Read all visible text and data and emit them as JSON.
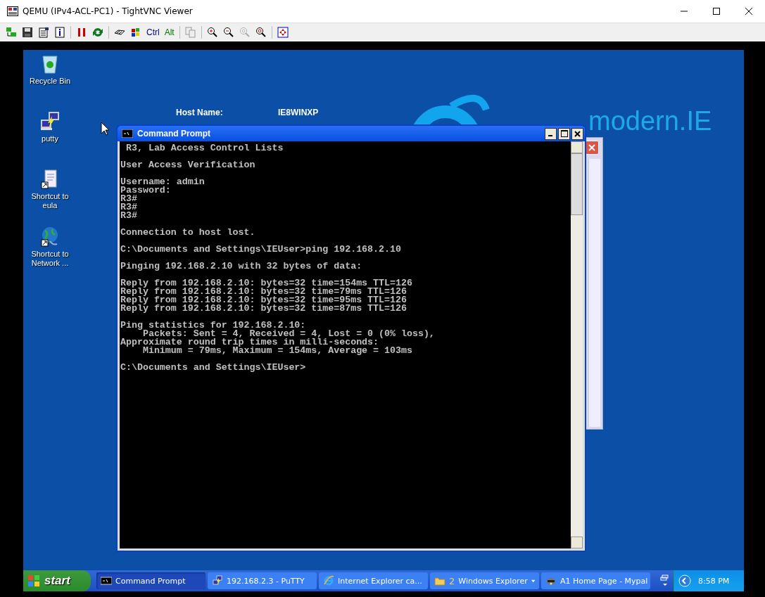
{
  "window": {
    "title": "QEMU (IPv4-ACL-PC1) - TightVNC Viewer"
  },
  "toolbar": {
    "keys": [
      "Ctrl",
      "Alt"
    ]
  },
  "desktop": {
    "icons": [
      {
        "label": "Recycle Bin",
        "kind": "recycle"
      },
      {
        "label": "putty",
        "kind": "putty"
      },
      {
        "label": "Shortcut to eula",
        "kind": "notepad"
      },
      {
        "label": "Shortcut to Network ...",
        "kind": "network"
      }
    ],
    "info": [
      {
        "label": "Host Name:",
        "value": "IE8WINXP"
      }
    ],
    "wallpaper_text": "modern.IE"
  },
  "console": {
    "title": "Command Prompt",
    "blocks": [
      [
        " R3, Lab Access Control Lists"
      ],
      [
        "User Access Verification"
      ],
      [
        "Username: admin",
        "Password:",
        "R3#",
        "R3#",
        "R3#"
      ],
      [
        "Connection to host lost."
      ],
      [
        "C:\\Documents and Settings\\IEUser>ping 192.168.2.10"
      ],
      [
        "Pinging 192.168.2.10 with 32 bytes of data:"
      ],
      [
        "Reply from 192.168.2.10: bytes=32 time=154ms TTL=126",
        "Reply from 192.168.2.10: bytes=32 time=79ms TTL=126",
        "Reply from 192.168.2.10: bytes=32 time=95ms TTL=126",
        "Reply from 192.168.2.10: bytes=32 time=87ms TTL=126"
      ],
      [
        "Ping statistics for 192.168.2.10:",
        "    Packets: Sent = 4, Received = 4, Lost = 0 (0% loss),",
        "Approximate round trip times in milli-seconds:",
        "    Minimum = 79ms, Maximum = 154ms, Average = 103ms"
      ],
      [
        "C:\\Documents and Settings\\IEUser>"
      ]
    ]
  },
  "taskbar": {
    "start": "start",
    "buttons": [
      {
        "label": "Command Prompt",
        "kind": "console",
        "selected": true
      },
      {
        "label": "192.168.2.3 - PuTTY",
        "kind": "putty",
        "selected": false
      },
      {
        "label": "Internet Explorer ca...",
        "kind": "browser",
        "selected": false
      },
      {
        "count": "2",
        "label": "Windows Explorer",
        "kind": "folder",
        "selected": false
      },
      {
        "label": "A1 Home Page - Mypal",
        "kind": "animal",
        "selected": false
      }
    ],
    "clock": "8:58 PM"
  }
}
